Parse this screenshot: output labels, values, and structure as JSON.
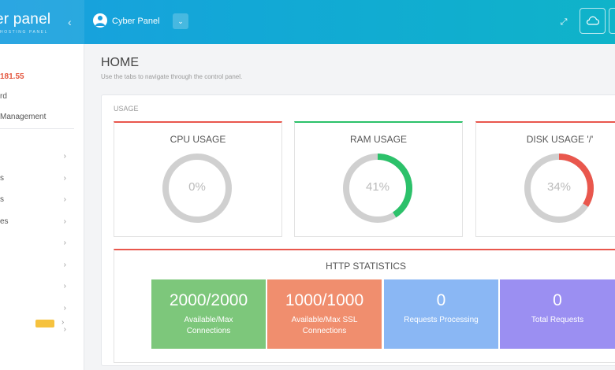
{
  "brand": {
    "logo": "er panel",
    "sub": "HOSTING PANEL"
  },
  "header": {
    "user_name": "Cyber Panel"
  },
  "sidebar": {
    "ip": "181.55",
    "links": [
      "rd",
      "Management"
    ],
    "items": [
      "",
      "s",
      "s",
      "es",
      "",
      "",
      "",
      "",
      ""
    ]
  },
  "page": {
    "title": "HOME",
    "subtitle": "Use the tabs to navigate through the control panel."
  },
  "usage": {
    "label": "USAGE",
    "cards": [
      {
        "title": "CPU USAGE",
        "percent_text": "0%",
        "percent": 0,
        "color": "#e9574d"
      },
      {
        "title": "RAM USAGE",
        "percent_text": "41%",
        "percent": 41,
        "color": "#2cc16a"
      },
      {
        "title": "DISK USAGE '/'",
        "percent_text": "34%",
        "percent": 34,
        "color": "#e9574d"
      }
    ]
  },
  "http": {
    "title": "HTTP STATISTICS",
    "stats": [
      {
        "value": "2000/2000",
        "label_1": "Available/Max",
        "label_2": "Connections",
        "color": "#7dc77b"
      },
      {
        "value": "1000/1000",
        "label_1": "Available/Max SSL",
        "label_2": "Connections",
        "color": "#f08e6e"
      },
      {
        "value": "0",
        "label_1": "Requests Processing",
        "label_2": "",
        "color": "#8ab7f4"
      },
      {
        "value": "0",
        "label_1": "Total Requests",
        "label_2": "",
        "color": "#9b8ff2"
      }
    ]
  },
  "colors": {
    "accent": "#1a9fe0",
    "gauge_track": "#d0d0d0"
  }
}
